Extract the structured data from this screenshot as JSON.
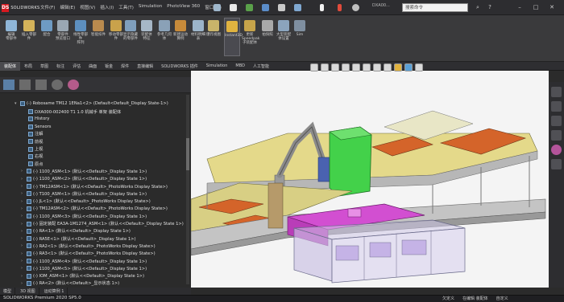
{
  "app": {
    "logo_text": "SOLIDWORKS",
    "menu": [
      "文件(F)",
      "编辑(E)",
      "视图(V)",
      "插入(I)",
      "工具(T)",
      "Simulation",
      "PhotoView 360",
      "窗口(W)"
    ],
    "doc_label": "DXA00...",
    "search_placeholder": "搜索命令"
  },
  "ribbon": {
    "buttons": [
      {
        "label": "编辑\n零部件",
        "color": "#8fb6d8",
        "icon": "edit-component-icon"
      },
      {
        "label": "插入零部件",
        "color": "#d4b35a",
        "icon": "insert-component-icon"
      },
      {
        "label": "配合",
        "color": "#6e9bc4",
        "icon": "mate-icon"
      },
      {
        "label": "零部件\n预览窗口",
        "color": "#9aa7b3",
        "icon": "preview-window-icon"
      },
      {
        "label": "线性零部件\n阵列",
        "color": "#5d8fbf",
        "icon": "linear-pattern-icon"
      },
      {
        "label": "智能扣件",
        "color": "#b98a4e",
        "icon": "smart-fastener-icon"
      },
      {
        "label": "移动零部件",
        "color": "#c9a24b",
        "icon": "move-component-icon"
      },
      {
        "label": "显示隐藏\n的零部件",
        "color": "#7f9fbd",
        "icon": "show-hidden-icon"
      },
      {
        "label": "装配体\n特征",
        "color": "#a6b7c7",
        "icon": "assembly-feature-icon"
      },
      {
        "label": "参考几何\n体",
        "color": "#8aa1b7",
        "icon": "reference-geometry-icon"
      },
      {
        "label": "新建运动\n算例",
        "color": "#c88b3a",
        "icon": "motion-study-icon"
      },
      {
        "label": "材料明细\n表",
        "color": "#9cb4c9",
        "icon": "bom-icon"
      },
      {
        "label": "爆炸视图",
        "color": "#c9b46a",
        "icon": "exploded-view-icon"
      },
      {
        "label": "Instant3D",
        "color": "#e0b340",
        "icon": "instant3d-icon"
      },
      {
        "label": "更新\nSpeedpak\n子装配体",
        "color": "#c7a44a",
        "icon": "speedpak-icon"
      },
      {
        "label": "拍快照",
        "color": "#a9a9a9",
        "icon": "snapshot-icon"
      },
      {
        "label": "大型装配\n体设置",
        "color": "#8ba4bd",
        "icon": "large-assembly-icon"
      },
      {
        "label": "Sim",
        "color": "#7f8fa0",
        "icon": "simulation-icon"
      }
    ]
  },
  "command_tabs": [
    "装配体",
    "布局",
    "草图",
    "标注",
    "评估",
    "曲面",
    "钣金",
    "焊件",
    "直接编辑",
    "SOLIDWORKS 插件",
    "Simulation",
    "MBD",
    "人工智能"
  ],
  "command_tabs_active": 0,
  "tree": {
    "root": "(-) Robosame TM12 1ENa1<2> (Default<Default_Display State-1>)",
    "rows": [
      "DXA000-002400 T1 1.0 机械手 单架 装配体",
      "History",
      "Sensors",
      "注解",
      "前视",
      "上视",
      "右视",
      "原点",
      "(-) 1100_ASM<1> (默认<<Default>_Display State 1>)",
      "(-) 1100_ASM<2> (默认<<Default>_Display State 1>)",
      "(-) TM12ASM<1> (默认<<Default>_PhotoWorks Display State>)",
      "(-) T100_ASM<1> (默认<<Default>_Display State 1>)",
      "(-) JL<1> (默认<<Default>_PhotoWorks Display State>)",
      "(-) TM12ASM<2> (默认<<Default>_PhotoWorks Display State>)",
      "(-) 1100_ASM<3> (默认<<Default>_Display State 1>)",
      "(-) 固定装配 EA3A-1M1274_ASM<1> (默认<<Default>_Display State 1>)",
      "(-) RA<1> (默认<<Default>_Display State 1>)",
      "(-) RA5E<1> (默认<<Default>_Display State 1>)",
      "(-) RA2<1> (默认<<Default>_PhotoWorks Display State>)",
      "(-) RA3<1> (默认<<Default>_PhotoWorks Display State>)",
      "(-) 1100_ASM<4> (默认<<Default>_Display State 1>)",
      "(-) 1100_ASM<5> (默认<<Default>_Display State 1>)",
      "(-) IOM_ASM<1> (默认<<Default>_Display State 1>)",
      "(-) RA<2> (默认<<Default>_显示状态 1>)",
      "(-) TM12(快速卸货)_ASM<1> (默认<<Default>_Display State 1>)"
    ]
  },
  "bottom_tabs": [
    "模型",
    "3D 视图",
    "运动算例 1"
  ],
  "status": {
    "left": "SOLIDWORKS Premium 2020 SP5.0",
    "right": [
      "欠定义",
      "在编辑 装配体",
      "自定义"
    ]
  }
}
